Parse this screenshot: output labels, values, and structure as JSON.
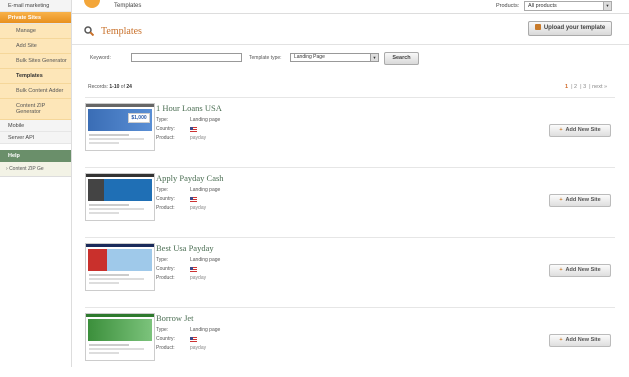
{
  "sidebar": {
    "top_item": "E-mail marketing",
    "active_section": "Private Sites",
    "sub_items": [
      "Manage",
      "Add Site",
      "Bulk Sites Generator",
      "Templates",
      "Bulk Content Adder",
      "Content ZIP Generator"
    ],
    "other_items": [
      "Mobile",
      "Server API"
    ],
    "help_title": "Help",
    "help_text": "Content ZIP Ge"
  },
  "topbar": {
    "title": "Templates",
    "products_label": "Products:",
    "products_value": "All products"
  },
  "header": {
    "title": "Templates",
    "upload_label": "Upload your template"
  },
  "filter": {
    "keyword_label": "Keyword:",
    "keyword_value": "",
    "type_label": "Template type:",
    "type_value": "Landing Page",
    "search_label": "Search"
  },
  "records": {
    "prefix": "Records: ",
    "range": "1-10",
    "of_word": " of ",
    "total": "24"
  },
  "pager": {
    "pages": [
      "1",
      "2",
      "3"
    ],
    "current": "1",
    "next": "next »"
  },
  "meta_labels": {
    "type": "Type:",
    "country": "Country:",
    "product": "Product:"
  },
  "add_label": "Add New Site",
  "templates": [
    {
      "title": "1 Hour Loans USA",
      "type": "Landing page",
      "country_icon": "us-flag-icon",
      "product": "payday"
    },
    {
      "title": "Apply Payday Cash",
      "type": "Landing page",
      "country_icon": "us-flag-icon",
      "product": "payday"
    },
    {
      "title": "Best Usa Payday",
      "type": "Landing page",
      "country_icon": "us-flag-icon",
      "product": "payday"
    },
    {
      "title": "Borrow Jet",
      "type": "Landing page",
      "country_icon": "us-flag-icon",
      "product": "payday"
    }
  ],
  "thumb_text": "$1,000",
  "colors": {
    "accent": "#e8901e",
    "title_green": "#4b6e53",
    "header_orange": "#c8702a",
    "help_green": "#6a8f6a"
  }
}
